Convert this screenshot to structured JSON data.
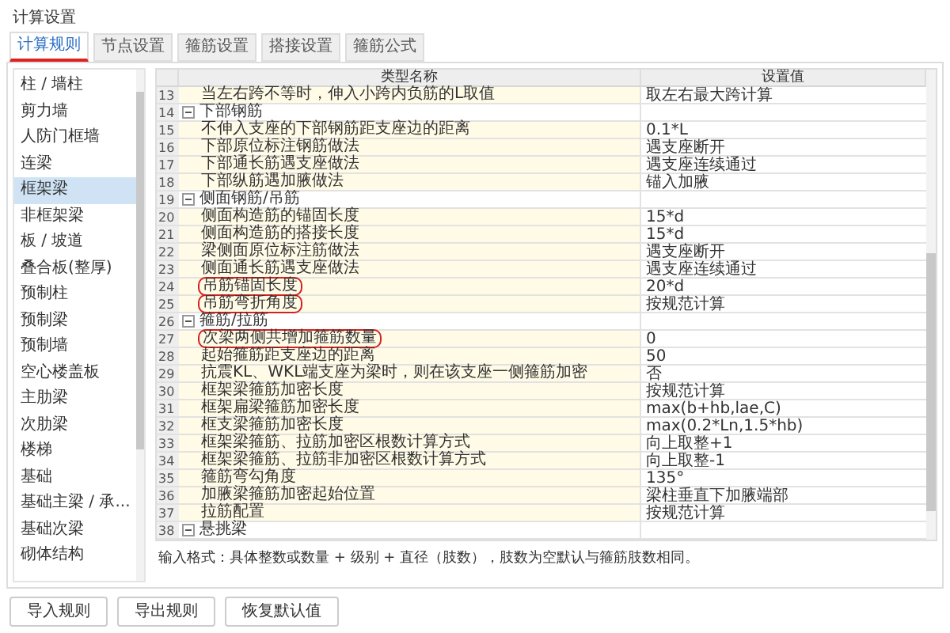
{
  "window": {
    "title": "计算设置"
  },
  "tabs": [
    {
      "label": "计算规则",
      "selected": true
    },
    {
      "label": "节点设置",
      "selected": false
    },
    {
      "label": "箍筋设置",
      "selected": false
    },
    {
      "label": "搭接设置",
      "selected": false
    },
    {
      "label": "箍筋公式",
      "selected": false
    }
  ],
  "sidebar": {
    "items": [
      {
        "label": "柱 / 墙柱",
        "selected": false
      },
      {
        "label": "剪力墙",
        "selected": false
      },
      {
        "label": "人防门框墙",
        "selected": false
      },
      {
        "label": "连梁",
        "selected": false
      },
      {
        "label": "框架梁",
        "selected": true
      },
      {
        "label": "非框架梁",
        "selected": false
      },
      {
        "label": "板 / 坡道",
        "selected": false
      },
      {
        "label": "叠合板(整厚)",
        "selected": false
      },
      {
        "label": "预制柱",
        "selected": false
      },
      {
        "label": "预制梁",
        "selected": false
      },
      {
        "label": "预制墙",
        "selected": false
      },
      {
        "label": "空心楼盖板",
        "selected": false
      },
      {
        "label": "主肋梁",
        "selected": false
      },
      {
        "label": "次肋梁",
        "selected": false
      },
      {
        "label": "楼梯",
        "selected": false
      },
      {
        "label": "基础",
        "selected": false
      },
      {
        "label": "基础主梁 / 承...",
        "selected": false
      },
      {
        "label": "基础次梁",
        "selected": false
      },
      {
        "label": "砌体结构",
        "selected": false
      }
    ]
  },
  "table": {
    "columns": [
      "类型名称",
      "设置值"
    ],
    "rows": [
      {
        "kind": "item",
        "no": "13",
        "name": "当左右跨不等时，伸入小跨内负筋的L取值",
        "value": "取左右最大跨计算"
      },
      {
        "kind": "group",
        "no": "14",
        "name": "下部钢筋",
        "expanded": true
      },
      {
        "kind": "item",
        "no": "15",
        "name": "不伸入支座的下部钢筋距支座边的距离",
        "value": "0.1*L"
      },
      {
        "kind": "item",
        "no": "16",
        "name": "下部原位标注钢筋做法",
        "value": "遇支座断开"
      },
      {
        "kind": "item",
        "no": "17",
        "name": "下部通长筋遇支座做法",
        "value": "遇支座连续通过"
      },
      {
        "kind": "item",
        "no": "18",
        "name": "下部纵筋遇加腋做法",
        "value": "锚入加腋"
      },
      {
        "kind": "group",
        "no": "19",
        "name": "侧面钢筋/吊筋",
        "expanded": true
      },
      {
        "kind": "item",
        "no": "20",
        "name": "侧面构造筋的锚固长度",
        "value": "15*d"
      },
      {
        "kind": "item",
        "no": "21",
        "name": "侧面构造筋的搭接长度",
        "value": "15*d"
      },
      {
        "kind": "item",
        "no": "22",
        "name": "梁侧面原位标注筋做法",
        "value": "遇支座断开"
      },
      {
        "kind": "item",
        "no": "23",
        "name": "侧面通长筋遇支座做法",
        "value": "遇支座连续通过"
      },
      {
        "kind": "item",
        "no": "24",
        "name": "吊筋锚固长度",
        "value": "20*d",
        "circled": true
      },
      {
        "kind": "item",
        "no": "25",
        "name": "吊筋弯折角度",
        "value": "按规范计算",
        "circled": true
      },
      {
        "kind": "group",
        "no": "26",
        "name": "箍筋/拉筋",
        "expanded": true
      },
      {
        "kind": "item",
        "no": "27",
        "name": "次梁两侧共增加箍筋数量",
        "value": "0",
        "circled": true
      },
      {
        "kind": "item",
        "no": "28",
        "name": "起始箍筋距支座边的距离",
        "value": "50"
      },
      {
        "kind": "item",
        "no": "29",
        "name": "抗震KL、WKL端支座为梁时，则在该支座一侧箍筋加密",
        "value": "否"
      },
      {
        "kind": "item",
        "no": "30",
        "name": "框架梁箍筋加密长度",
        "value": "按规范计算"
      },
      {
        "kind": "item",
        "no": "31",
        "name": "框架扁梁箍筋加密长度",
        "value": "max(b+hb,lae,C)"
      },
      {
        "kind": "item",
        "no": "32",
        "name": "框支梁箍筋加密长度",
        "value": "max(0.2*Ln,1.5*hb)"
      },
      {
        "kind": "item",
        "no": "33",
        "name": "框架梁箍筋、拉筋加密区根数计算方式",
        "value": "向上取整+1"
      },
      {
        "kind": "item",
        "no": "34",
        "name": "框架梁箍筋、拉筋非加密区根数计算方式",
        "value": "向上取整-1"
      },
      {
        "kind": "item",
        "no": "35",
        "name": "箍筋弯勾角度",
        "value": "135°"
      },
      {
        "kind": "item",
        "no": "36",
        "name": "加腋梁箍筋加密起始位置",
        "value": "梁柱垂直下加腋端部"
      },
      {
        "kind": "item",
        "no": "37",
        "name": "拉筋配置",
        "value": "按规范计算"
      },
      {
        "kind": "group",
        "no": "38",
        "name": "悬挑梁",
        "expanded": true
      }
    ]
  },
  "hint": "输入格式：具体整数或数量 + 级别 + 直径（肢数），肢数为空默认与箍筋肢数相同。",
  "buttons": [
    "导入规则",
    "导出规则",
    "恢复默认值"
  ]
}
